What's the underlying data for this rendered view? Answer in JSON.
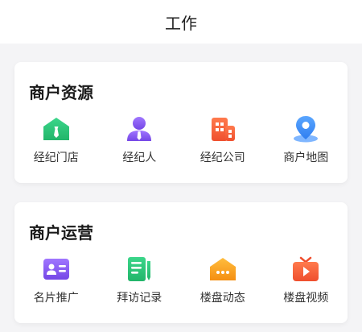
{
  "header": {
    "title": "工作"
  },
  "sections": [
    {
      "title": "商户资源",
      "items": [
        {
          "label": "经纪门店",
          "icon": "store-icon"
        },
        {
          "label": "经纪人",
          "icon": "agent-icon"
        },
        {
          "label": "经纪公司",
          "icon": "company-building-icon"
        },
        {
          "label": "商户地图",
          "icon": "map-pin-icon"
        }
      ]
    },
    {
      "title": "商户运营",
      "items": [
        {
          "label": "名片推广",
          "icon": "business-card-icon"
        },
        {
          "label": "拜访记录",
          "icon": "visit-record-icon"
        },
        {
          "label": "楼盘动态",
          "icon": "property-news-icon"
        },
        {
          "label": "楼盘视频",
          "icon": "property-video-icon"
        }
      ]
    }
  ],
  "colors": {
    "green": "#2fc47a",
    "purple": "#8a5cf0",
    "orange_red": "#f5603d",
    "blue": "#3b8bf5",
    "amber": "#f8a21b"
  }
}
